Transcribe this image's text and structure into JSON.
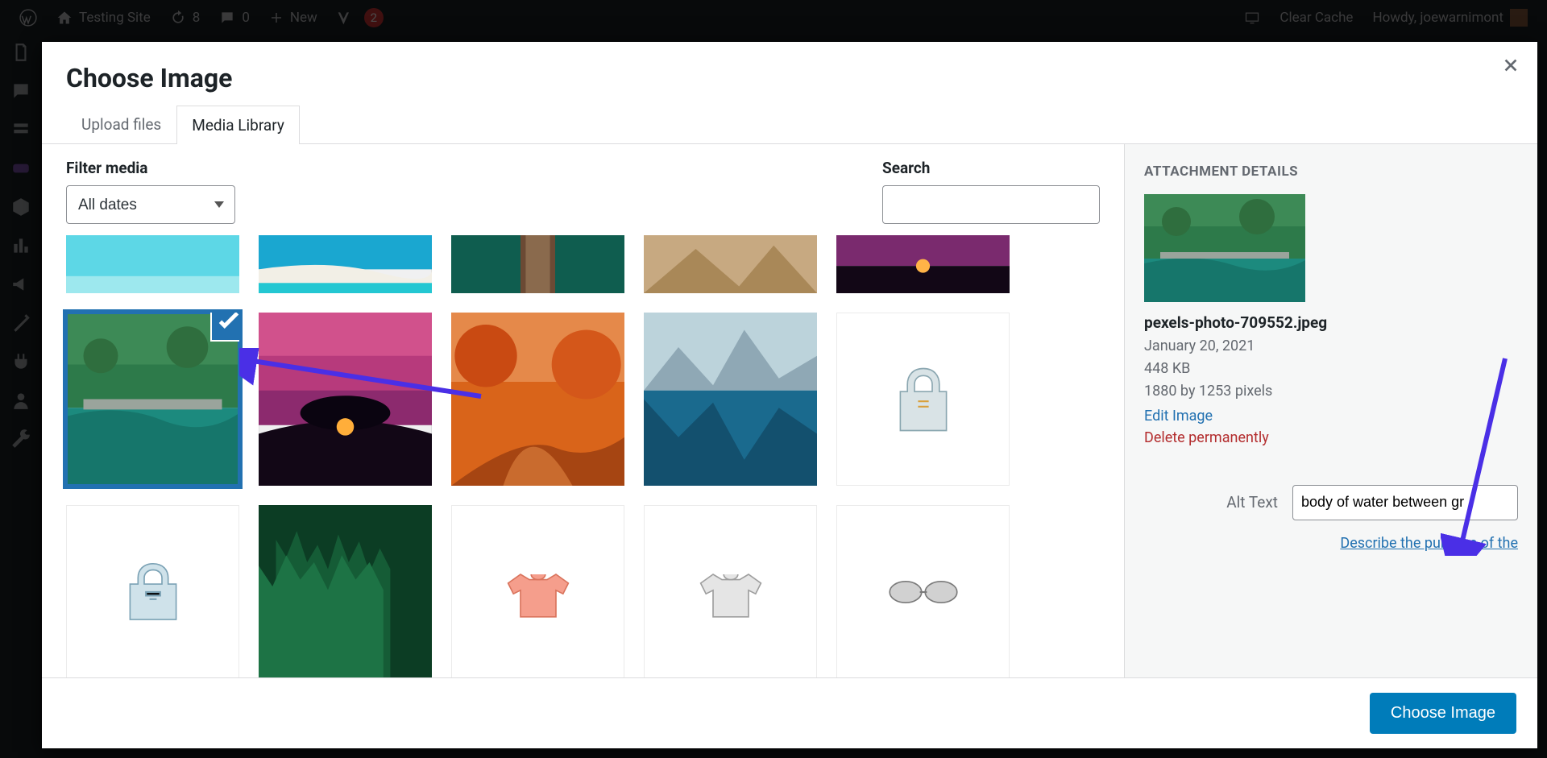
{
  "admin_bar": {
    "site_name": "Testing Site",
    "updates_count": "8",
    "comments_count": "0",
    "new_label": "New",
    "yoast_count": "2",
    "clear_cache": "Clear Cache",
    "howdy": "Howdy, joewarnimont"
  },
  "sidebar_bottom": {
    "settings": "Settings"
  },
  "modal": {
    "title": "Choose Image",
    "tabs": {
      "upload": "Upload files",
      "library": "Media Library"
    },
    "filter": {
      "label": "Filter media",
      "date_value": "All dates"
    },
    "search": {
      "label": "Search",
      "value": ""
    },
    "footer_button": "Choose Image"
  },
  "attachment": {
    "heading": "ATTACHMENT DETAILS",
    "filename": "pexels-photo-709552.jpeg",
    "date": "January 20, 2021",
    "size": "448 KB",
    "dimensions": "1880 by 1253 pixels",
    "edit_link": "Edit Image",
    "delete_link": "Delete permanently",
    "alt_label": "Alt Text",
    "alt_value": "body of water between gr",
    "describe_link": "Describe the purpose of the"
  }
}
